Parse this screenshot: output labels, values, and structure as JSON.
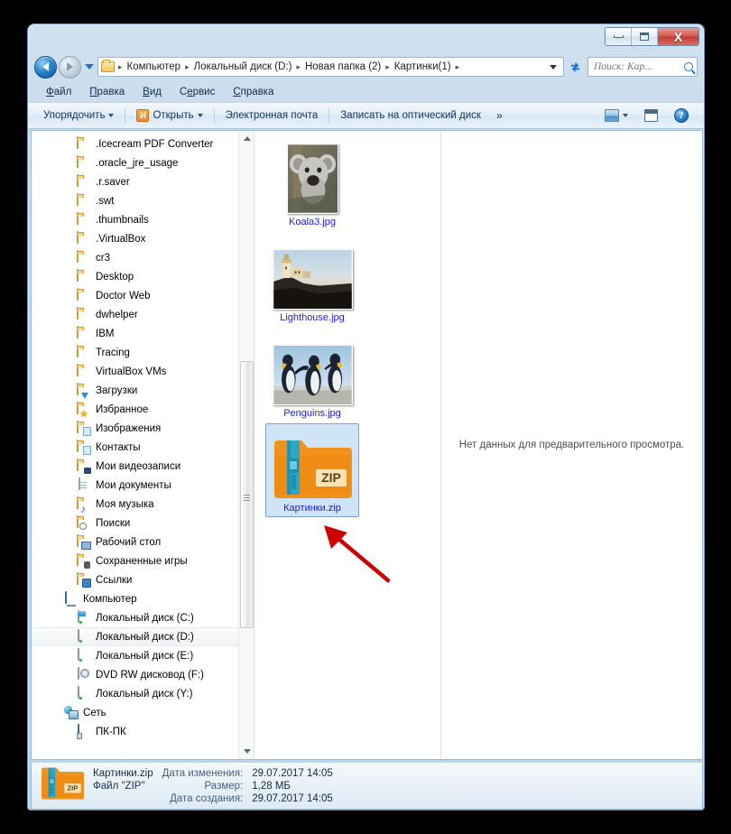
{
  "window": {
    "minimize_label": "Свернуть",
    "maximize_label": "Развернуть",
    "close_label": "X"
  },
  "address": {
    "back_label": "Назад",
    "forward_label": "Вперед",
    "recent_label": "Последние страницы",
    "breadcrumbs": [
      "Компьютер",
      "Локальный диск (D:)",
      "Новая папка (2)",
      "Картинки(1)"
    ],
    "separator": "▸",
    "refresh_label": "Обновить",
    "dropdown_label": "Предыдущие папки"
  },
  "search": {
    "placeholder": "Поиск: Кар...",
    "value": ""
  },
  "menu": {
    "items": [
      {
        "pre": "",
        "acc": "Ф",
        "post": "айл"
      },
      {
        "pre": "",
        "acc": "П",
        "post": "равка"
      },
      {
        "pre": "",
        "acc": "В",
        "post": "ид"
      },
      {
        "pre": "С",
        "acc": "е",
        "post": "рвис"
      },
      {
        "pre": "",
        "acc": "С",
        "post": "правка"
      }
    ]
  },
  "toolbar": {
    "organize_label": "Упорядочить",
    "open_label": "Открыть",
    "open_icon_letter": "И",
    "email_label": "Электронная почта",
    "burn_label": "Записать на оптический диск",
    "overflow_label": "»",
    "view_label": "Изменить представление",
    "preview_pane_label": "Показать область предварительного просмотра",
    "help_label": "?"
  },
  "navpane": {
    "items": [
      {
        "label": ".Icecream PDF Converter",
        "icon": "folder-icon",
        "indent": 2,
        "selected": false
      },
      {
        "label": ".oracle_jre_usage",
        "icon": "folder-icon",
        "indent": 2,
        "selected": false
      },
      {
        "label": ".r.saver",
        "icon": "folder-icon",
        "indent": 2,
        "selected": false
      },
      {
        "label": ".swt",
        "icon": "folder-icon",
        "indent": 2,
        "selected": false
      },
      {
        "label": ".thumbnails",
        "icon": "folder-icon",
        "indent": 2,
        "selected": false
      },
      {
        "label": ".VirtualBox",
        "icon": "folder-icon",
        "indent": 2,
        "selected": false
      },
      {
        "label": "cr3",
        "icon": "folder-icon",
        "indent": 2,
        "selected": false
      },
      {
        "label": "Desktop",
        "icon": "folder-icon",
        "indent": 2,
        "selected": false
      },
      {
        "label": "Doctor Web",
        "icon": "folder-icon",
        "indent": 2,
        "selected": false
      },
      {
        "label": "dwhelper",
        "icon": "folder-icon",
        "indent": 2,
        "selected": false
      },
      {
        "label": "IBM",
        "icon": "folder-icon",
        "indent": 2,
        "selected": false
      },
      {
        "label": "Tracing",
        "icon": "folder-icon",
        "indent": 2,
        "selected": false
      },
      {
        "label": "VirtualBox VMs",
        "icon": "folder-icon",
        "indent": 2,
        "selected": false
      },
      {
        "label": "Загрузки",
        "icon": "downloads-folder-icon",
        "indent": 2,
        "selected": false
      },
      {
        "label": "Избранное",
        "icon": "favorites-folder-icon",
        "indent": 2,
        "selected": false
      },
      {
        "label": "Изображения",
        "icon": "pictures-folder-icon",
        "indent": 2,
        "selected": false
      },
      {
        "label": "Контакты",
        "icon": "contacts-folder-icon",
        "indent": 2,
        "selected": false
      },
      {
        "label": "Мои видеозаписи",
        "icon": "videos-folder-icon",
        "indent": 2,
        "selected": false
      },
      {
        "label": "Мои документы",
        "icon": "documents-folder-icon",
        "indent": 2,
        "selected": false
      },
      {
        "label": "Моя музыка",
        "icon": "music-folder-icon",
        "indent": 2,
        "selected": false
      },
      {
        "label": "Поиски",
        "icon": "searches-folder-icon",
        "indent": 2,
        "selected": false
      },
      {
        "label": "Рабочий стол",
        "icon": "desktop-folder-icon",
        "indent": 2,
        "selected": false
      },
      {
        "label": "Сохраненные игры",
        "icon": "saved-games-folder-icon",
        "indent": 2,
        "selected": false
      },
      {
        "label": "Ссылки",
        "icon": "links-folder-icon",
        "indent": 2,
        "selected": false
      },
      {
        "label": "Компьютер",
        "icon": "computer-icon",
        "indent": 1,
        "selected": false
      },
      {
        "label": "Локальный диск (C:)",
        "icon": "system-drive-icon",
        "indent": 2,
        "selected": false
      },
      {
        "label": "Локальный диск (D:)",
        "icon": "drive-icon",
        "indent": 2,
        "selected": true
      },
      {
        "label": "Локальный диск (E:)",
        "icon": "drive-icon",
        "indent": 2,
        "selected": false
      },
      {
        "label": "DVD RW дисковод (F:)",
        "icon": "dvd-drive-icon",
        "indent": 2,
        "selected": false
      },
      {
        "label": "Локальный диск (Y:)",
        "icon": "drive-icon",
        "indent": 2,
        "selected": false
      },
      {
        "label": "Сеть",
        "icon": "network-icon",
        "indent": 1,
        "selected": false
      },
      {
        "label": "ПК-ПК",
        "icon": "pc-icon",
        "indent": 2,
        "selected": false
      }
    ]
  },
  "files": [
    {
      "name": "Koala3.jpg",
      "type": "image-thumbnail",
      "orientation": "portrait",
      "selected": false
    },
    {
      "name": "Lighthouse.jpg",
      "type": "image-thumbnail",
      "orientation": "landscape",
      "selected": false
    },
    {
      "name": "Penguins.jpg",
      "type": "image-thumbnail",
      "orientation": "landscape",
      "selected": false
    },
    {
      "name": "Картинки.zip",
      "type": "zip-archive-icon",
      "orientation": "square",
      "selected": true
    }
  ],
  "preview": {
    "message": "Нет данных для предварительного просмотра."
  },
  "details": {
    "filename": "Картинки.zip",
    "filetype": "Файл \"ZIP\"",
    "rows": [
      {
        "key": "Дата изменения:",
        "value": "29.07.2017 14:05"
      },
      {
        "key": "Размер:",
        "value": "1,28 МБ"
      },
      {
        "key": "Дата создания:",
        "value": "29.07.2017 14:05"
      }
    ]
  },
  "annotation": {
    "arrow_color": "#cc0000",
    "points_to": "Картинки.zip"
  },
  "colors": {
    "selection_fill": "#cfe4f7",
    "selection_border": "#7da2ce",
    "filename_text": "#1c1ce0",
    "zip_orange": "#f0921e",
    "zip_teal": "#2ba7c6",
    "window_frame": "#bed5e9"
  }
}
